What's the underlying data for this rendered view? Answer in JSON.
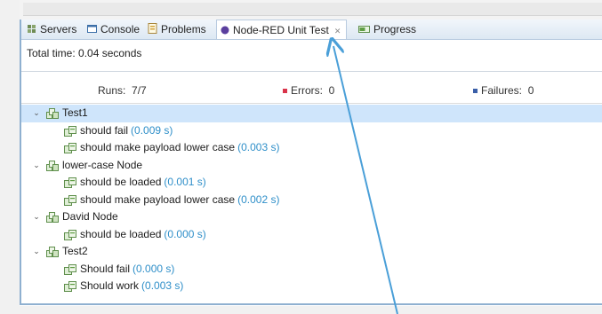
{
  "tabs": [
    {
      "label": "Servers",
      "icon": "servers-icon",
      "active": false
    },
    {
      "label": "Console",
      "icon": "console-icon",
      "active": false
    },
    {
      "label": "Problems",
      "icon": "problems-icon",
      "active": false
    },
    {
      "label": "Node-RED Unit Test",
      "icon": "node-red-icon",
      "active": true,
      "close_glyph": "✕"
    },
    {
      "label": "Progress",
      "icon": "progress-icon",
      "active": false
    }
  ],
  "summary": {
    "total_time": "Total time: 0.04 seconds",
    "runs_label": "Runs:",
    "runs_value": "7/7",
    "errors_label": "Errors:",
    "errors_value": "0",
    "failures_label": "Failures:",
    "failures_value": "0"
  },
  "suites": [
    {
      "name": "Test1",
      "expanded": true,
      "selected": true,
      "tests": [
        {
          "name": "should fail",
          "duration": "(0.009 s)"
        },
        {
          "name": "should make payload lower case",
          "duration": "(0.003 s)"
        }
      ]
    },
    {
      "name": "lower-case Node",
      "expanded": true,
      "selected": false,
      "tests": [
        {
          "name": "should be loaded",
          "duration": "(0.001 s)"
        },
        {
          "name": "should make payload lower case",
          "duration": "(0.002 s)"
        }
      ]
    },
    {
      "name": "David Node",
      "expanded": true,
      "selected": false,
      "tests": [
        {
          "name": "should be loaded",
          "duration": "(0.000 s)"
        }
      ]
    },
    {
      "name": "Test2",
      "expanded": true,
      "selected": false,
      "tests": [
        {
          "name": "Should fail",
          "duration": "(0.000 s)"
        },
        {
          "name": "Should work",
          "duration": "(0.003 s)"
        }
      ]
    }
  ],
  "colors": {
    "accent": "#2f8fc9",
    "selection": "#cfe5fb",
    "error": "#d9334a",
    "failure": "#3a5fa8",
    "annotation_arrow": "#4a9fd8"
  }
}
